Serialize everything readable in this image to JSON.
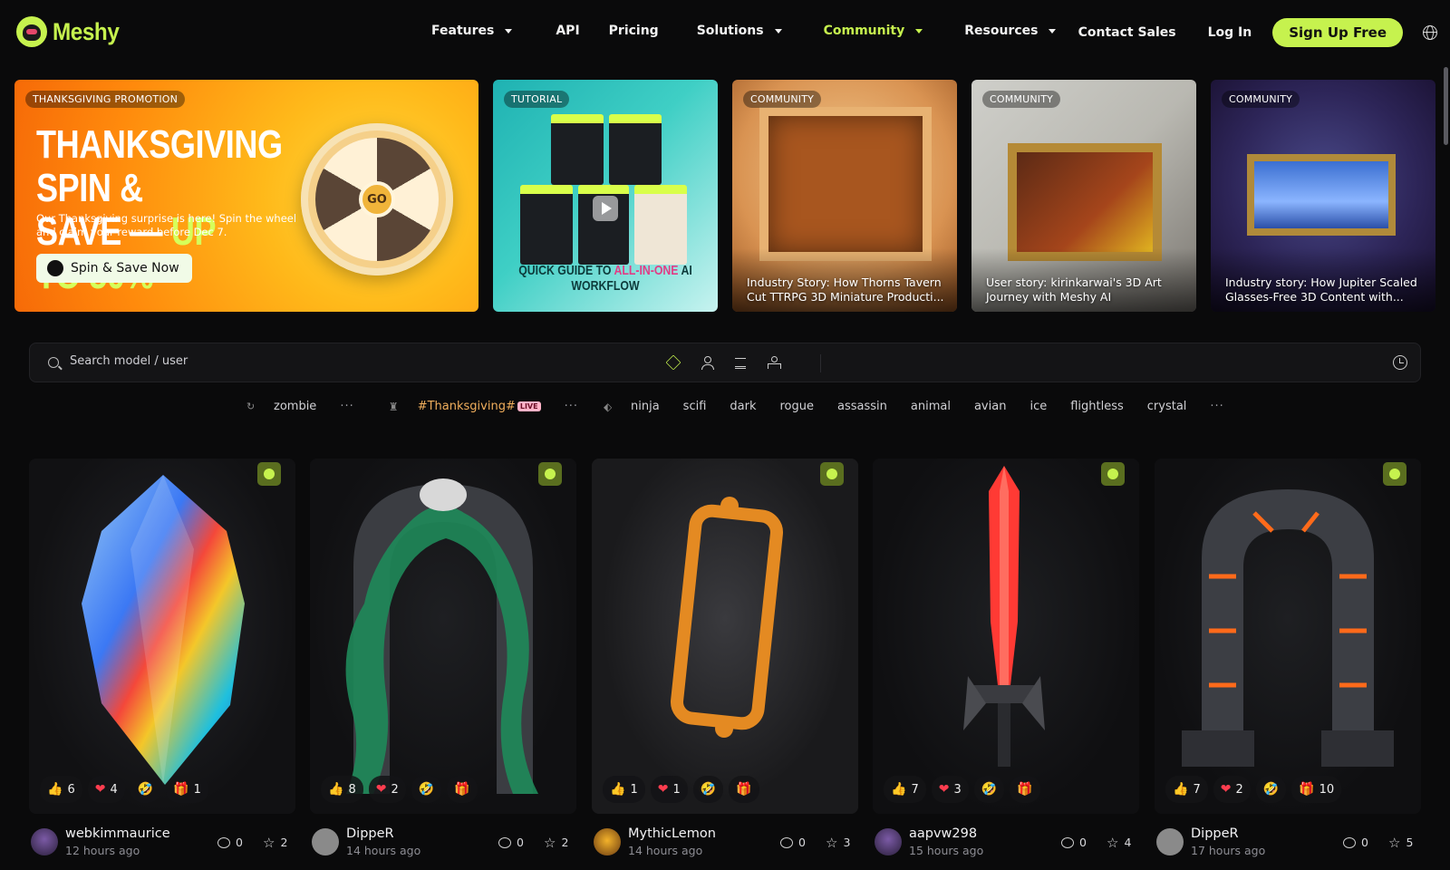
{
  "brand": {
    "name": "Meshy",
    "accent": "#c6f24e"
  },
  "nav": {
    "links": [
      {
        "label": "Features",
        "dropdown": true
      },
      {
        "label": "API",
        "dropdown": false
      },
      {
        "label": "Pricing",
        "dropdown": false
      },
      {
        "label": "Solutions",
        "dropdown": true
      },
      {
        "label": "Community",
        "dropdown": true,
        "active": true
      },
      {
        "label": "Resources",
        "dropdown": true
      }
    ],
    "contact": "Contact Sales",
    "login": "Log In",
    "signup": "Sign Up Free",
    "language_icon": "globe-icon"
  },
  "banners": [
    {
      "badge": "THANKSGIVING PROMOTION",
      "title_a": "THANKSGIVING SPIN &",
      "title_b": "SAVE — ",
      "title_hl": "UP TO 50%",
      "subtitle": "Our Thanksgiving surprise is here! Spin the wheel and claim your reward before Dec 7.",
      "cta": "Spin & Save Now",
      "wheel_center": "GO"
    },
    {
      "badge": "TUTORIAL",
      "footer_a": "QUICK GUIDE TO ",
      "footer_hl": "ALL-IN-ONE",
      "footer_b": " AI WORKFLOW"
    },
    {
      "badge": "COMMUNITY",
      "caption": "Industry Story: How Thorns Tavern Cut TTRPG 3D Miniature Producti..."
    },
    {
      "badge": "COMMUNITY",
      "caption": "User story: kirinkarwai's 3D Art Journey with Meshy AI"
    },
    {
      "badge": "COMMUNITY",
      "caption": "Industry story: How Jupiter Scaled Glasses-Free 3D Content with..."
    }
  ],
  "search": {
    "placeholder": "Search model / user"
  },
  "tags": {
    "recent": "zombie",
    "trending": "#Thanksgiving#",
    "live": "LIVE",
    "more": "···",
    "items": [
      "ninja",
      "scifi",
      "dark",
      "rogue",
      "assassin",
      "animal",
      "avian",
      "ice",
      "flightless",
      "crystal"
    ]
  },
  "models": [
    {
      "user": "webkimmaurice",
      "time": "12 hours ago",
      "likes": "6",
      "hearts": "4",
      "gifts": "1",
      "comments": "0",
      "stars": "2"
    },
    {
      "user": "DippeR",
      "time": "14 hours ago",
      "likes": "8",
      "hearts": "2",
      "gifts": "",
      "comments": "0",
      "stars": "2"
    },
    {
      "user": "MythicLemon",
      "time": "14 hours ago",
      "likes": "1",
      "hearts": "1",
      "gifts": "",
      "comments": "0",
      "stars": "3"
    },
    {
      "user": "aapvw298",
      "time": "15 hours ago",
      "likes": "7",
      "hearts": "3",
      "gifts": "",
      "comments": "0",
      "stars": "4"
    },
    {
      "user": "DippeR",
      "time": "17 hours ago",
      "likes": "7",
      "hearts": "2",
      "gifts": "10",
      "comments": "0",
      "stars": "5"
    }
  ]
}
